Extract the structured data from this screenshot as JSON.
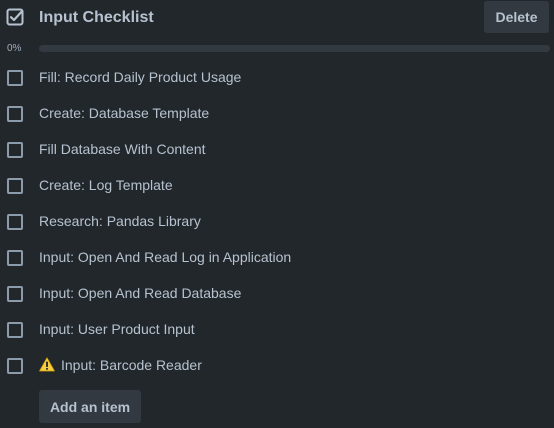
{
  "checklist": {
    "header_icon": "checklist-icon",
    "title": "Input Checklist",
    "delete_label": "Delete",
    "progress": {
      "label": "0%",
      "percent": 0
    },
    "items": [
      {
        "label": "Fill: Record Daily Product Usage",
        "checked": false
      },
      {
        "label": "Create: Database Template",
        "checked": false
      },
      {
        "label": "Fill Database With Content",
        "checked": false
      },
      {
        "label": "Create: Log Template",
        "checked": false
      },
      {
        "label": "Research: Pandas Library",
        "checked": false
      },
      {
        "label": "Input: Open And Read Log in Application",
        "checked": false
      },
      {
        "label": "Input: Open And Read Database",
        "checked": false
      },
      {
        "label": "Input: User Product Input",
        "checked": false
      },
      {
        "label": "Input: Barcode Reader",
        "checked": false,
        "icon": "warning-icon"
      }
    ],
    "add_item_label": "Add an item"
  },
  "colors": {
    "background": "#22272b",
    "text": "#b6c2cf",
    "button_bg": "#323940",
    "checkbox_border": "#8c9bab",
    "warning": "#f5cd47"
  }
}
